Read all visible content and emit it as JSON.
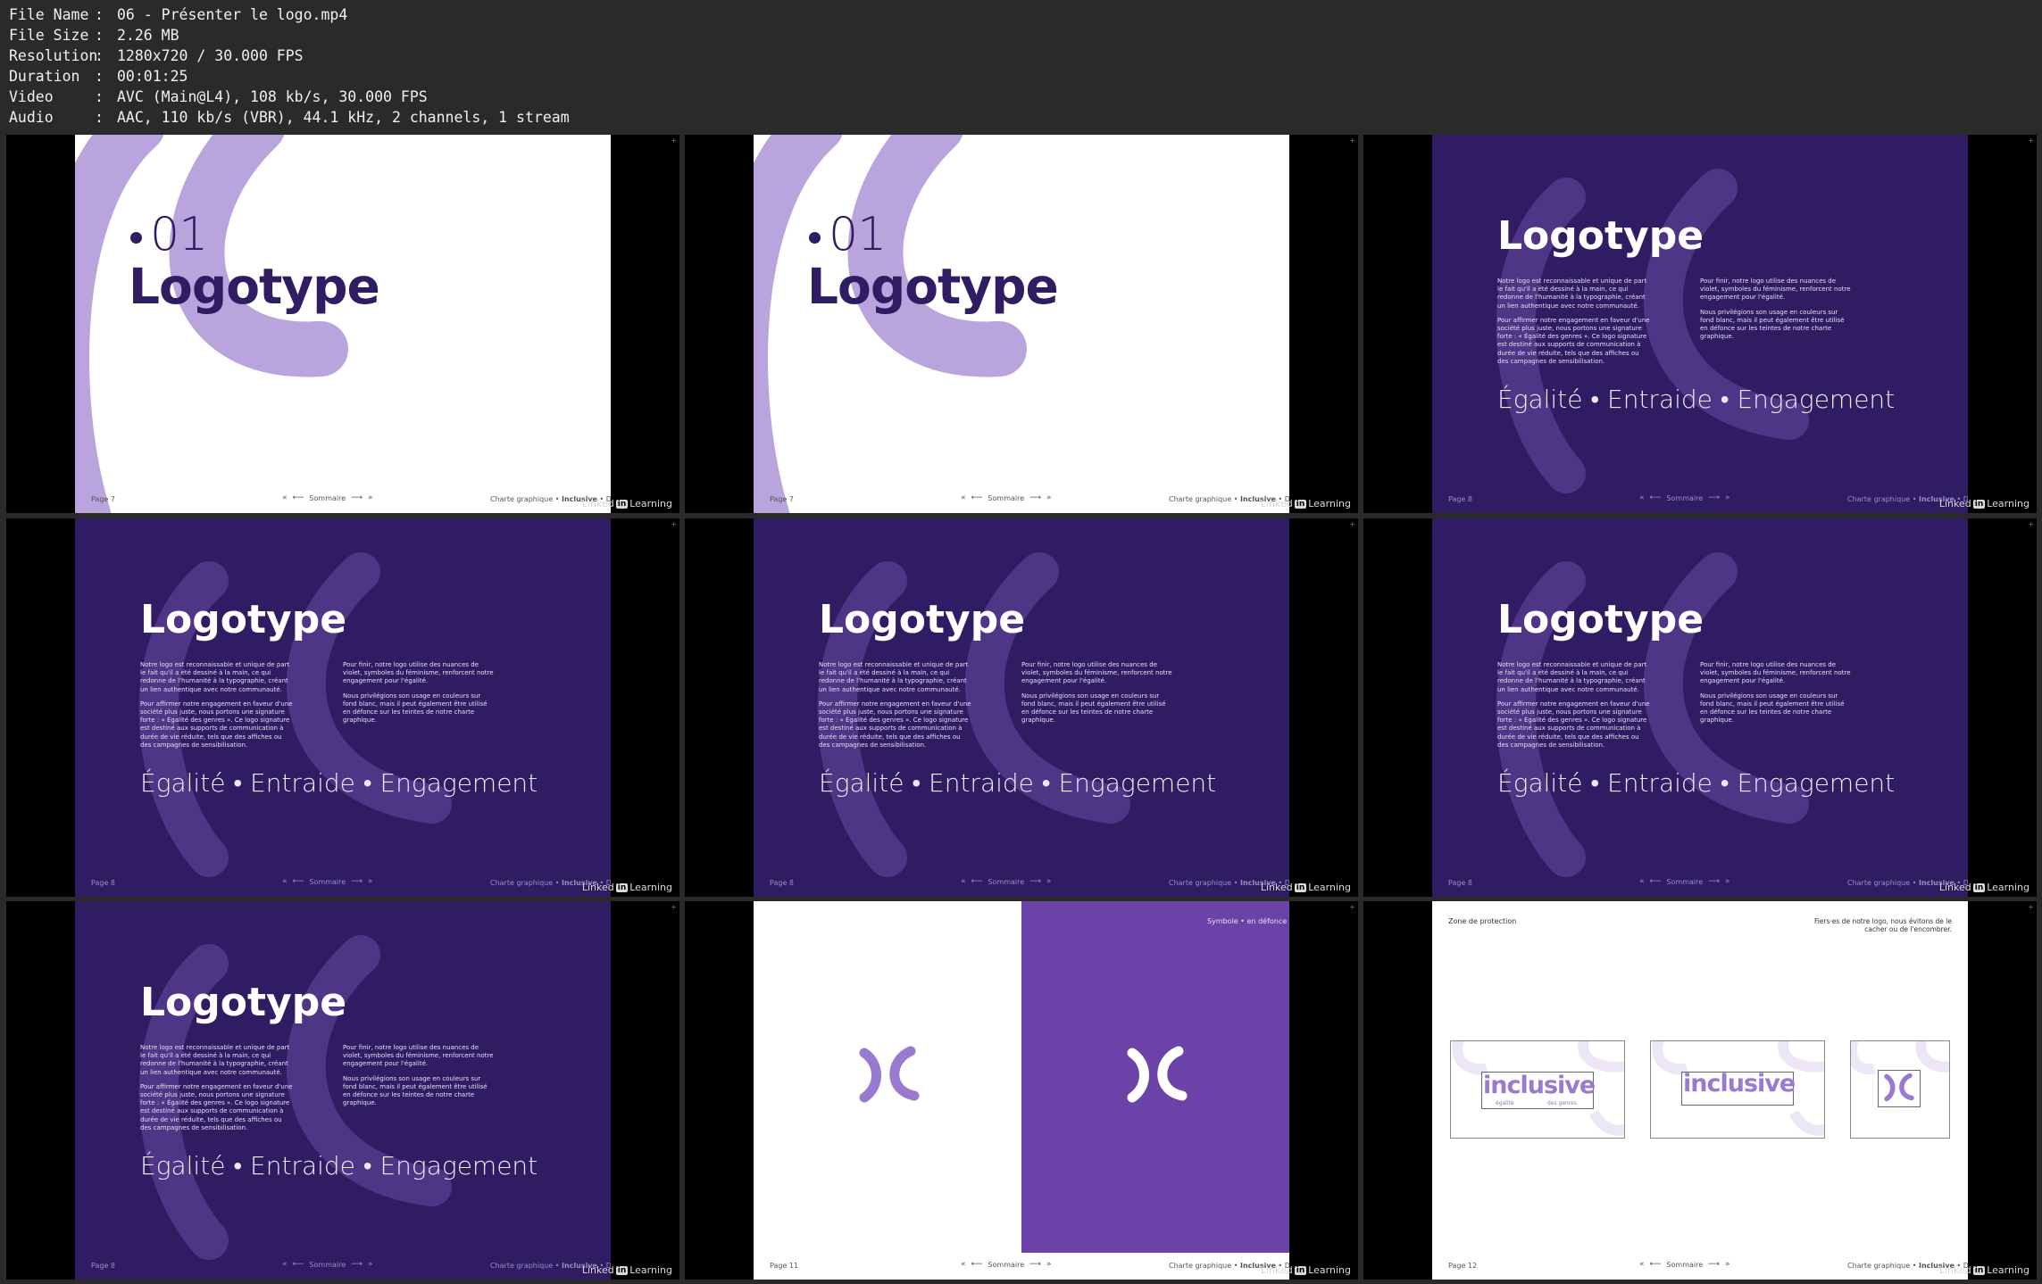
{
  "meta": [
    {
      "key": "File Name",
      "value": "06 - Présenter le logo.mp4"
    },
    {
      "key": "File Size",
      "value": "2.26 MB"
    },
    {
      "key": "Resolution",
      "value": "1280x720 / 30.000 FPS"
    },
    {
      "key": "Duration",
      "value": "00:01:25"
    },
    {
      "key": "Video",
      "value": "AVC (Main@L4), 108 kb/s, 30.000 FPS"
    },
    {
      "key": "Audio",
      "value": "AAC, 110 kb/s (VBR), 44.1 kHz, 2 channels, 1 stream"
    }
  ],
  "sep": ":",
  "colors": {
    "purple_dark": "#2f1c62",
    "purple_light": "#b9a4dd",
    "purple_mid": "#6a42a8",
    "logo": "#9a79d0"
  },
  "slide_num": "01",
  "title": "Logotype",
  "para1": "Notre logo est reconnaissable et unique de part le fait qu'il a été dessiné à la main, ce qui redonne de l'humanité à la typographie, créant un lien authentique avec notre communauté.",
  "para2": "Pour affirmer notre engagement en faveur d'une société plus juste, nous portons une signature forte : « Égalité des genres ». Ce logo signature est destiné aux supports de communication à durée de vie réduite, tels que des affiches ou des campagnes de sensibilisation.",
  "para3": "Pour finir, notre logo utilise des nuances de violet, symboles du féminisme, renforcent notre engagement pour l'égalité.",
  "para4": "Nous privilégions son usage en couleurs sur fond blanc, mais il peut également être utilisé en défonce sur les teintes de notre charte graphique.",
  "tagline": "Égalité • Entraide • Engagement",
  "footer": {
    "sommaire": "Sommaire",
    "left_arrows": "«",
    "right_arrows": "»",
    "left_arrow": "⟵",
    "right_arrow": "⟶",
    "charte": "Charte graphique • ",
    "brand": "Inclusive",
    "date": " • Date"
  },
  "linkedin": {
    "linked": "Linked",
    "in": "in",
    "learning": "Learning"
  },
  "corner_mark": "+",
  "pages": [
    "Page 7",
    "Page 7",
    "Page 8",
    "Page 8",
    "Page 8",
    "Page 8",
    "Page 8",
    "Page 11",
    "Page 12"
  ],
  "symbol_label": "Symbole • en défonce",
  "protection_label": "Zone de protection",
  "protection_note": "Fiers·es de notre logo, nous évitons de le cacher ou de l'encombrer.",
  "logo": {
    "word": "inclusive",
    "sub_left": "égalité",
    "sub_right": "des genres"
  }
}
